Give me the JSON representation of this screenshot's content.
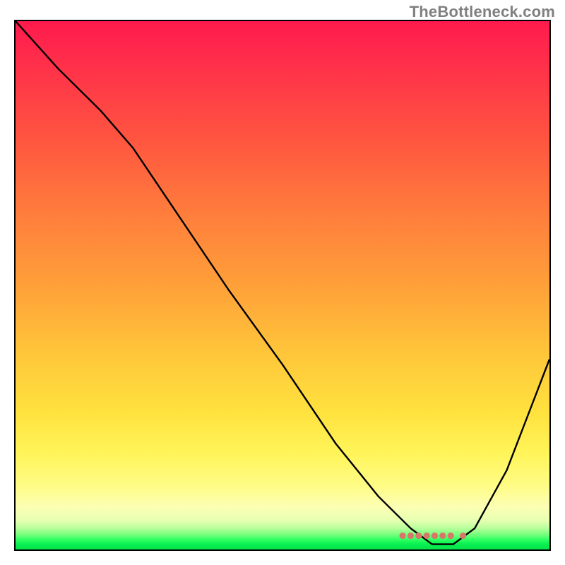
{
  "watermark": "TheBottleneck.com",
  "chart_data": {
    "type": "line",
    "title": "",
    "xlabel": "",
    "ylabel": "",
    "xlim": [
      0,
      100
    ],
    "ylim": [
      0,
      100
    ],
    "grid": false,
    "legend": false,
    "gradient_stops": [
      {
        "pct": 0,
        "color": "#ff1a4d"
      },
      {
        "pct": 8,
        "color": "#ff2f4a"
      },
      {
        "pct": 22,
        "color": "#ff5440"
      },
      {
        "pct": 36,
        "color": "#ff7c3c"
      },
      {
        "pct": 50,
        "color": "#ffa039"
      },
      {
        "pct": 63,
        "color": "#ffc63a"
      },
      {
        "pct": 74,
        "color": "#ffe23e"
      },
      {
        "pct": 82,
        "color": "#fff55a"
      },
      {
        "pct": 88,
        "color": "#fffc86"
      },
      {
        "pct": 92,
        "color": "#fcffb4"
      },
      {
        "pct": 94.5,
        "color": "#e7ffb2"
      },
      {
        "pct": 96,
        "color": "#b7ff9a"
      },
      {
        "pct": 97.3,
        "color": "#6fff7a"
      },
      {
        "pct": 98.2,
        "color": "#2cff60"
      },
      {
        "pct": 99,
        "color": "#08f050"
      },
      {
        "pct": 100,
        "color": "#05e24a"
      }
    ],
    "series": [
      {
        "name": "bottleneck-curve",
        "color": "#000000",
        "stroke_width": 2.2,
        "x": [
          0,
          8,
          16,
          22,
          30,
          40,
          50,
          60,
          68,
          74,
          78,
          82,
          86,
          92,
          100
        ],
        "y": [
          100,
          91,
          83,
          76,
          64,
          49,
          35,
          20,
          10,
          4,
          1,
          1,
          4,
          15,
          36
        ]
      }
    ],
    "markers": {
      "name": "optimal-range-dots",
      "color": "#d9766a",
      "radius": 4.6,
      "x": [
        72.5,
        74.0,
        75.5,
        77.0,
        78.5,
        80.0,
        81.5,
        83.8
      ],
      "y": [
        2.6,
        2.6,
        2.6,
        2.6,
        2.6,
        2.6,
        2.6,
        2.6
      ]
    }
  }
}
